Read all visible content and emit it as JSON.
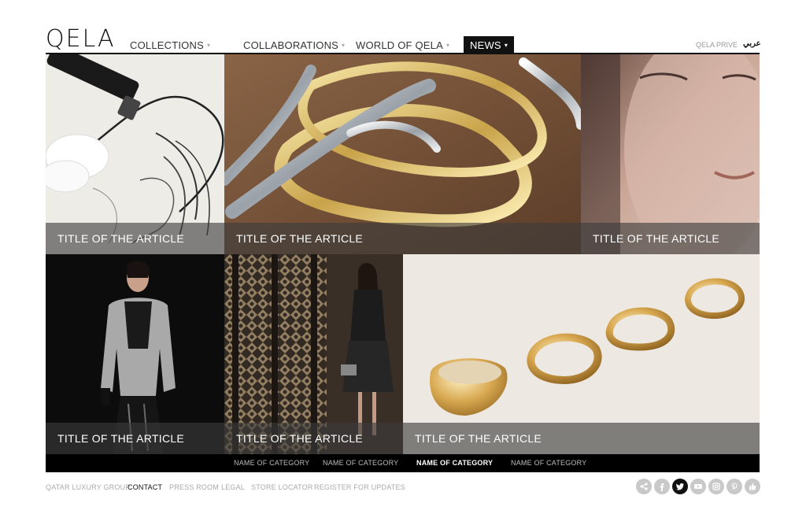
{
  "header": {
    "logo": "QELA",
    "nav": [
      {
        "label": "COLLECTIONS",
        "caret": "▾"
      },
      {
        "label": "COLLABORATIONS",
        "caret": "▾"
      },
      {
        "label": "WORLD OF QELA",
        "caret": "▾"
      },
      {
        "label": "NEWS",
        "caret": "▾"
      }
    ],
    "prive": "QELA PRIVE",
    "language": "عربي"
  },
  "articles": [
    {
      "title": "TITLE OF THE ARTICLE",
      "image": "sketch-with-pen"
    },
    {
      "title": "TITLE OF THE ARTICLE",
      "image": "silver-gold-bangles"
    },
    {
      "title": "TITLE OF THE ARTICLE",
      "image": "woman-face-closeup"
    },
    {
      "title": "TITLE OF THE ARTICLE",
      "image": "runway-model"
    },
    {
      "title": "TITLE OF THE ARTICLE",
      "image": "model-with-lattice-screen"
    },
    {
      "title": "TITLE OF THE ARTICLE",
      "image": "gold-rings"
    }
  ],
  "categories": [
    "NAME OF CATEGORY",
    "NAME OF CATEGORY",
    "NAME OF CATEGORY",
    "NAME OF CATEGORY"
  ],
  "footer": {
    "links": [
      "QATAR LUXURY GROUP",
      "CONTACT",
      "PRESS ROOM",
      "LEGAL",
      "STORE LOCATOR",
      "REGISTER FOR UPDATES"
    ]
  },
  "social": [
    "share-icon",
    "facebook-icon",
    "twitter-icon",
    "youtube-icon",
    "instagram-icon",
    "pinterest-icon",
    "like-icon"
  ],
  "colors": {
    "accent": "#111111",
    "overlay": "#3c3c3c",
    "muted": "#aaaaaa"
  }
}
